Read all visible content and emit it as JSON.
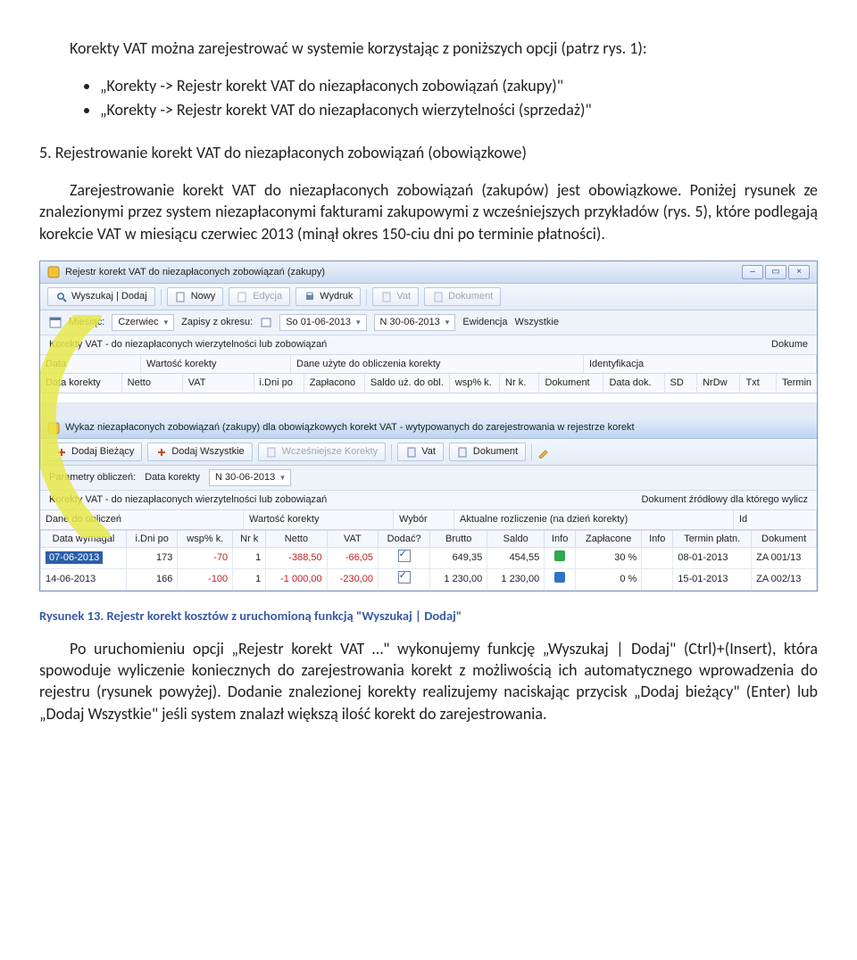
{
  "intro": "Korekty VAT można zarejestrować w systemie korzystając z poniższych opcji (patrz rys. 1):",
  "bullets": [
    "„Korekty -> Rejestr korekt VAT do niezapłaconych zobowiązań (zakupy)\"",
    "„Korekty -> Rejestr korekt VAT do niezapłaconych wierzytelności (sprzedaż)\""
  ],
  "heading": "5. Rejestrowanie korekt VAT do niezapłaconych zobowiązań (obowiązkowe)",
  "para1": "Zarejestrowanie korekt VAT do niezapłaconych zobowiązań (zakupów) jest obowiązkowe. Poniżej rysunek ze znalezionymi przez system niezapłaconymi fakturami zakupowymi z wcześniejszych przykładów (rys. 5), które podlegają korekcie VAT w miesiącu czerwiec 2013 (minął okres 150-ciu dni po terminie płatności).",
  "shot": {
    "win1": {
      "title": "Rejestr korekt VAT do niezapłaconych zobowiązań (zakupy)",
      "tb": {
        "search": "Wyszukaj | Dodaj",
        "nowy": "Nowy",
        "edycja": "Edycja",
        "wydruk": "Wydruk",
        "vat": "Vat",
        "dok": "Dokument"
      },
      "filter": {
        "mies_lbl": "Miesiąc:",
        "mies_val": "Czerwiec",
        "zap_lbl": "Zapisy z okresu:",
        "d1": "So 01-06-2013",
        "d2": "N 30-06-2013",
        "ewid_lbl": "Ewidencja",
        "ewid_val": "Wszystkie"
      },
      "ghead_l": "Korekty VAT - do niezapłaconych wierzytelności lub zobowiązań",
      "ghead_r": "Dokume",
      "sub": {
        "a": "Data",
        "b": "Wartość korekty",
        "c": "Dane użyte do obliczenia korekty",
        "d": "Identyfikacja"
      },
      "cols": [
        "Data korekty",
        "Netto",
        "VAT",
        "i.Dni po",
        "Zapłacono",
        "Saldo uż. do obl.",
        "wsp% k.",
        "Nr k.",
        "Dokument",
        "Data dok.",
        "SD",
        "NrDw",
        "Txt",
        "Termin"
      ]
    },
    "win2": {
      "title": "Wykaz niezapłaconych zobowiązań (zakupy) dla obowiązkowych korekt VAT - wytypowanych do zarejestrowania w rejestrze korekt",
      "tb": {
        "addcur": "Dodaj Bieżący",
        "addall": "Dodaj Wszystkie",
        "prev": "Wcześniejsze Korekty",
        "vat": "Vat",
        "dok": "Dokument"
      },
      "params": {
        "lbl": "Parametry obliczeń:",
        "dk_lbl": "Data korekty",
        "dk_val": "N 30-06-2013"
      },
      "ghead_l": "Korekty VAT - do niezapłaconych wierzytelności lub zobowiązań",
      "ghead_r": "Dokument źródłowy dla którego wylicz",
      "sub": {
        "a": "Dane do obliczeń",
        "b": "Wartość korekty",
        "c": "Wybór",
        "d": "Aktualne rozliczenie (na dzień korekty)",
        "e": "Id"
      },
      "cols": [
        "Data wymagal",
        "i.Dni po",
        "wsp% k.",
        "Nr k",
        "Netto",
        "VAT",
        "Dodać?",
        "Brutto",
        "Saldo",
        "Info",
        "Zapłacone",
        "Info",
        "Termin płatn.",
        "Dokument"
      ],
      "rows": [
        {
          "dw": "07-06-2013",
          "dni": "173",
          "wsp": "-70",
          "nr": "1",
          "netto": "-388,50",
          "vat": "-66,05",
          "add": true,
          "br": "649,35",
          "saldo": "454,55",
          "sq": "g",
          "zap": "30 %",
          "tpl": "08-01-2013",
          "dok": "ZA 001/13"
        },
        {
          "dw": "14-06-2013",
          "dni": "166",
          "wsp": "-100",
          "nr": "1",
          "netto": "-1 000,00",
          "vat": "-230,00",
          "add": true,
          "br": "1 230,00",
          "saldo": "1 230,00",
          "sq": "b",
          "zap": "0 %",
          "tpl": "15-01-2013",
          "dok": "ZA 002/13"
        }
      ]
    }
  },
  "caption": "Rysunek 13. Rejestr korekt kosztów z uruchomioną funkcją \"Wyszukaj | Dodaj\"",
  "para2": "Po uruchomieniu opcji „Rejestr korekt VAT …\" wykonujemy funkcję „Wyszukaj | Dodaj\" (Ctrl)+(Insert), która spowoduje wyliczenie koniecznych do zarejestrowania korekt z możliwością ich automatycznego wprowadzenia do rejestru (rysunek powyżej). Dodanie znalezionej korekty realizujemy naciskając przycisk „Dodaj bieżący\" (Enter)  lub „Dodaj Wszystkie\" jeśli system znalazł większą ilość korekt do zarejestrowania."
}
